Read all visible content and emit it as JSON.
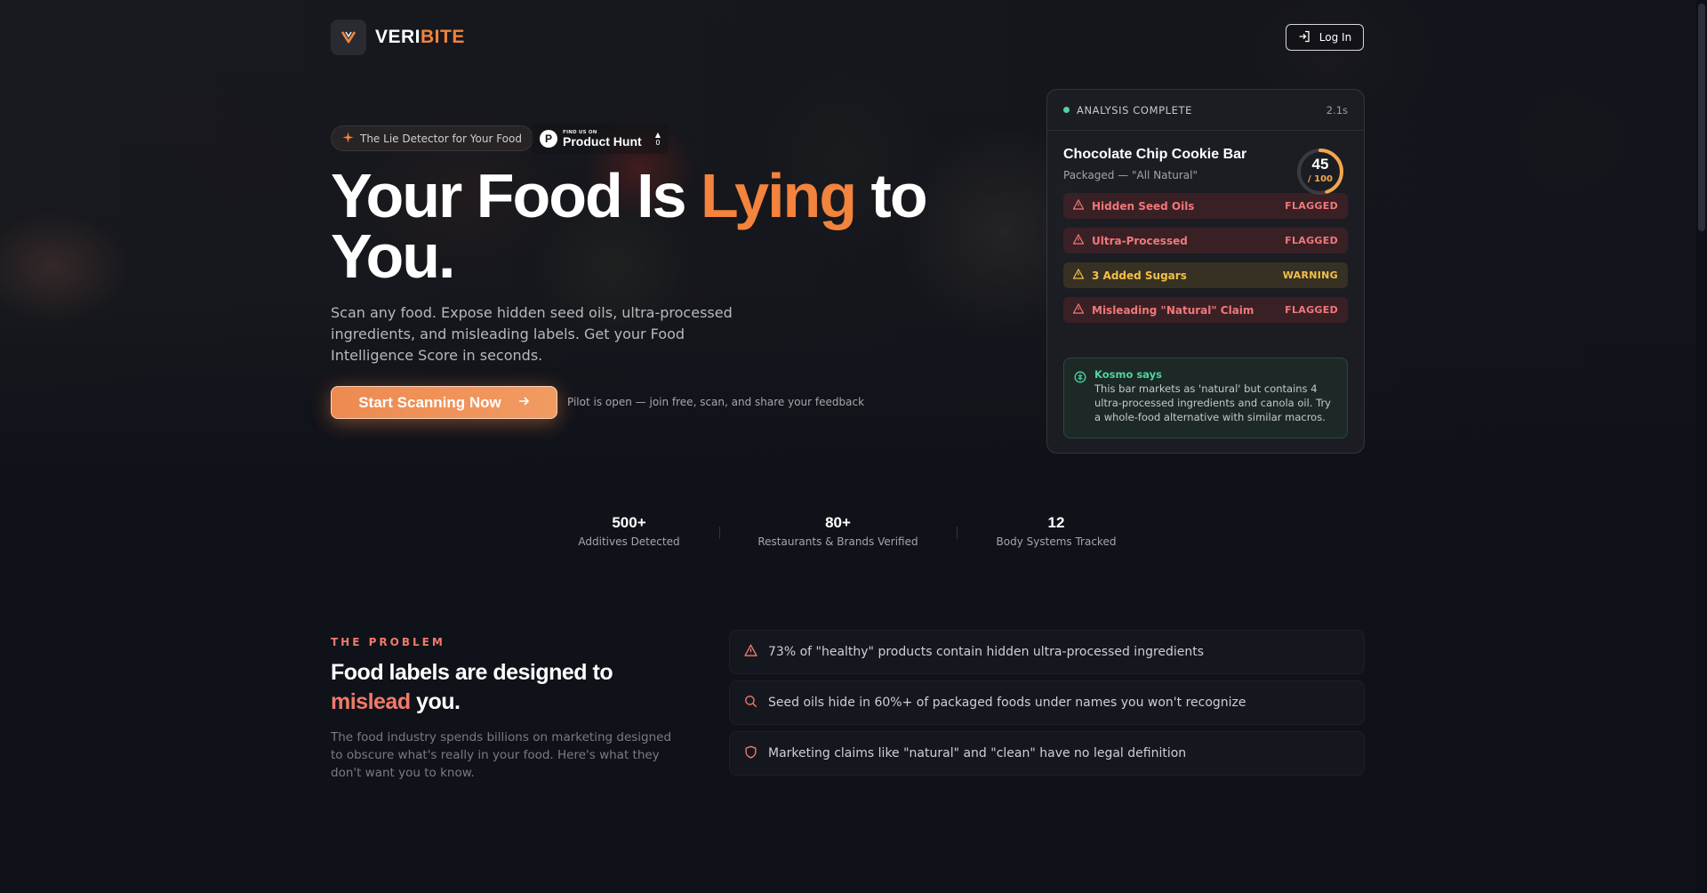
{
  "brand": {
    "name_part1": "VERI",
    "name_part2": "BITE",
    "accent": "#f3833d"
  },
  "header": {
    "login_label": "Log In",
    "login_icon": "login-icon"
  },
  "hero": {
    "tagline": "The Lie Detector for Your Food",
    "tagline_icon": "sparkle-icon",
    "product_hunt": {
      "small": "FIND US ON",
      "name": "Product Hunt",
      "votes": "0"
    },
    "headline_part1": "Your Food Is ",
    "headline_accent": "Lying",
    "headline_part2": " to You.",
    "subcopy": "Scan any food. Expose hidden seed oils, ultra-processed ingredients, and misleading labels. Get your Food Intelligence Score in seconds.",
    "cta_label": "Start Scanning Now",
    "cta_note": "Pilot is open — join free, scan, and share your feedback"
  },
  "analysis_card": {
    "status": "ANALYSIS COMPLETE",
    "time": "2.1s",
    "product_name": "Chocolate Chip Cookie Bar",
    "product_sub": "Packaged — \"All Natural\"",
    "score": "45",
    "score_max": "/ 100",
    "score_fraction": 0.45,
    "flags": [
      {
        "label": "Hidden Seed Oils",
        "status": "FLAGGED",
        "level": "red"
      },
      {
        "label": "Ultra-Processed",
        "status": "FLAGGED",
        "level": "red"
      },
      {
        "label": "3 Added Sugars",
        "status": "WARNING",
        "level": "amber"
      },
      {
        "label": "Misleading \"Natural\" Claim",
        "status": "FLAGGED",
        "level": "red"
      }
    ],
    "kosmo_title": "Kosmo says",
    "kosmo_text": "This bar markets as 'natural' but contains 4 ultra-processed ingredients and canola oil. Try a whole-food alternative with similar macros."
  },
  "stats": [
    {
      "value": "500+",
      "label": "Additives Detected"
    },
    {
      "value": "80+",
      "label": "Restaurants & Brands Verified"
    },
    {
      "value": "12",
      "label": "Body Systems Tracked"
    }
  ],
  "problem": {
    "eyebrow": "THE PROBLEM",
    "title_part1": "Food labels are designed to ",
    "title_accent": "mislead",
    "title_part2": " you.",
    "body": "The food industry spends billions on marketing designed to obscure what's really in your food. Here's what they don't want you to know.",
    "items": [
      {
        "icon": "warning-icon",
        "text": "73% of \"healthy\" products contain hidden ultra-processed ingredients"
      },
      {
        "icon": "search-icon",
        "text": "Seed oils hide in 60%+ of packaged foods under names you won't recognize"
      },
      {
        "icon": "shield-icon",
        "text": "Marketing claims like \"natural\" and \"clean\" have no legal definition"
      }
    ]
  },
  "colors": {
    "background": "#10121a",
    "accent": "#f3833d",
    "flag_red": "#f0787a",
    "flag_amber": "#f4c04a",
    "kosmo_green": "#4fd49d"
  }
}
